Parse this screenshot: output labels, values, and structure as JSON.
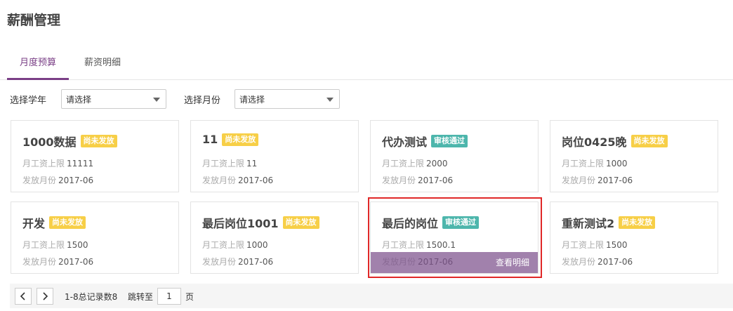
{
  "header": {
    "title": "薪酬管理"
  },
  "tabs": [
    {
      "label": "月度预算",
      "active": true
    },
    {
      "label": "薪资明细",
      "active": false
    }
  ],
  "filters": {
    "year_label": "选择学年",
    "year_value": "请选择",
    "month_label": "选择月份",
    "month_value": "请选择"
  },
  "fields": {
    "salary_limit": "月工资上限",
    "pay_month": "发放月份"
  },
  "cards": [
    {
      "name": "1000数据",
      "status": "尚未发放",
      "status_type": "pending",
      "salary_limit": "11111",
      "pay_month": "2017-06"
    },
    {
      "name": "11",
      "status": "尚未发放",
      "status_type": "pending",
      "salary_limit": "11",
      "pay_month": "2017-06"
    },
    {
      "name": "代办测试",
      "status": "审核通过",
      "status_type": "approved",
      "salary_limit": "2000",
      "pay_month": "2017-06"
    },
    {
      "name": "岗位0425晚",
      "status": "尚未发放",
      "status_type": "pending",
      "salary_limit": "1000",
      "pay_month": "2017-06"
    },
    {
      "name": "开发",
      "status": "尚未发放",
      "status_type": "pending",
      "salary_limit": "1500",
      "pay_month": "2017-06"
    },
    {
      "name": "最后岗位1001",
      "status": "尚未发放",
      "status_type": "pending",
      "salary_limit": "1000",
      "pay_month": "2017-06"
    },
    {
      "name": "最后的岗位",
      "status": "审核通过",
      "status_type": "approved",
      "salary_limit": "1500.1",
      "pay_month": "2017-06",
      "hover_action": "查看明细"
    },
    {
      "name": "重新测试2",
      "status": "尚未发放",
      "status_type": "pending",
      "salary_limit": "1500",
      "pay_month": "2017-06"
    }
  ],
  "pagination": {
    "summary": "1-8总记录数8",
    "jump_label": "跳转至",
    "page_value": "1",
    "page_suffix": "页"
  },
  "colors": {
    "accent": "#7a3f86",
    "pending": "#f7cf47",
    "approved": "#4db6ac",
    "highlight": "#e02828"
  }
}
